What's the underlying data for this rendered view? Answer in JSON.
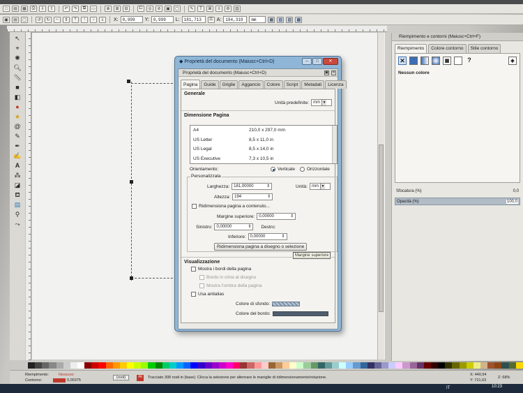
{
  "toolbar_top": {
    "icons": [
      "new-icon",
      "open-icon",
      "save-icon",
      "print-icon",
      "import-icon",
      "export-icon",
      "undo-icon",
      "redo-icon",
      "copy-icon",
      "paste-icon",
      "zoom-selection-icon",
      "zoom-drawing-icon",
      "zoom-page-icon",
      "duplicate-icon",
      "clone-icon",
      "unlink-icon",
      "group-icon",
      "ungroup-icon",
      "fill-stroke-icon",
      "text-icon",
      "xml-editor-icon",
      "align-icon",
      "preferences-icon",
      "document-props-icon"
    ]
  },
  "toolbar_select": {
    "x_label": "X:",
    "x_value": "0,999",
    "y_label": "Y:",
    "y_value": "0,999",
    "w_label": "L:",
    "w_value": "181,713",
    "h_label": "A:",
    "h_value": "194,319",
    "unit": "mm"
  },
  "dialog": {
    "window_title": "Proprietà del documento (Maiusc+Ctrl+D)",
    "inner_title": "Proprietà del documento (Maiusc+Ctrl+D)",
    "tabs": [
      "Pagina",
      "Guide",
      "Griglie",
      "Aggancio",
      "Colore",
      "Script",
      "Metadati",
      "Licenza"
    ],
    "general_header": "Generale",
    "default_units_label": "Unità predefinite:",
    "default_units_value": "mm",
    "page_size_header": "Dimensione Pagina",
    "page_sizes": [
      {
        "name": "A4",
        "size": "210,0 x 297,0 mm"
      },
      {
        "name": "US Letter",
        "size": "8,5 x 11,0 in"
      },
      {
        "name": "US Legal",
        "size": "8,5 x 14,0 in"
      },
      {
        "name": "US Executive",
        "size": "7,3 x 10,5 in"
      }
    ],
    "orientation_label": "Orientamento:",
    "orientation_vertical": "Verticale",
    "orientation_horizontal": "Orizzontale",
    "custom_label": "Personalizzata",
    "width_label": "Larghezza:",
    "width_value": "181,00000",
    "height_label": "Altezza:",
    "height_value": "194",
    "unit_label": "Unità:",
    "unit_value": "mm",
    "resize_check_label": "Ridimensiona pagina a contenuto...",
    "margin_top_label": "Margine superiore:",
    "margin_top_value": "0,00000",
    "left_label": "Sinistro:",
    "left_value": "0,00000",
    "right_label": "Destro:",
    "bottom_label": "Inferiore:",
    "bottom_value": "0,00000",
    "resize_button": "Ridimensiona pagina a disegno o selezione",
    "tooltip": "Margine superiore",
    "display_header": "Visualizzazione",
    "show_border_label": "Mostra i bordi della pagina",
    "border_on_top_label": "Bordo in cima al disegno",
    "show_shadow_label": "Mostra l'ombra della pagina",
    "antialias_label": "Usa antialias",
    "bg_color_label": "Colore di sfondo:",
    "border_color_label": "Colore del bordo:"
  },
  "dock": {
    "title": "Riempimento e contorni (Maiusc+Ctrl+F)",
    "tabs": [
      "Riempimento",
      "Colore contorno",
      "Stile contorno"
    ],
    "no_paint_label": "Nessun colore",
    "blur_label": "Sfocatura (%)",
    "blur_value": "0,0",
    "opacity_label": "Opacità (%)",
    "opacity_value": "100,0"
  },
  "statusbar": {
    "fill_label": "Riempimento:",
    "fill_value": "Nessuno",
    "stroke_label": "Contorno:",
    "stroke_value": "0,00375",
    "layer": "(root)",
    "message": "Tracciato 308 nodi in (base). Clicca la selezione per alternare le maniglie di ridimensionamento/rotazione.",
    "coords_x": "X: 440,94",
    "coords_y": "Y: 721,63",
    "zoom": "Z: 68%"
  },
  "taskbar": {
    "lang": "IT",
    "time": "10:23"
  },
  "colors": {
    "accent": "#3f6fa8",
    "dialog_frame": "#8fb6d6",
    "close_red": "#c94a3c"
  }
}
